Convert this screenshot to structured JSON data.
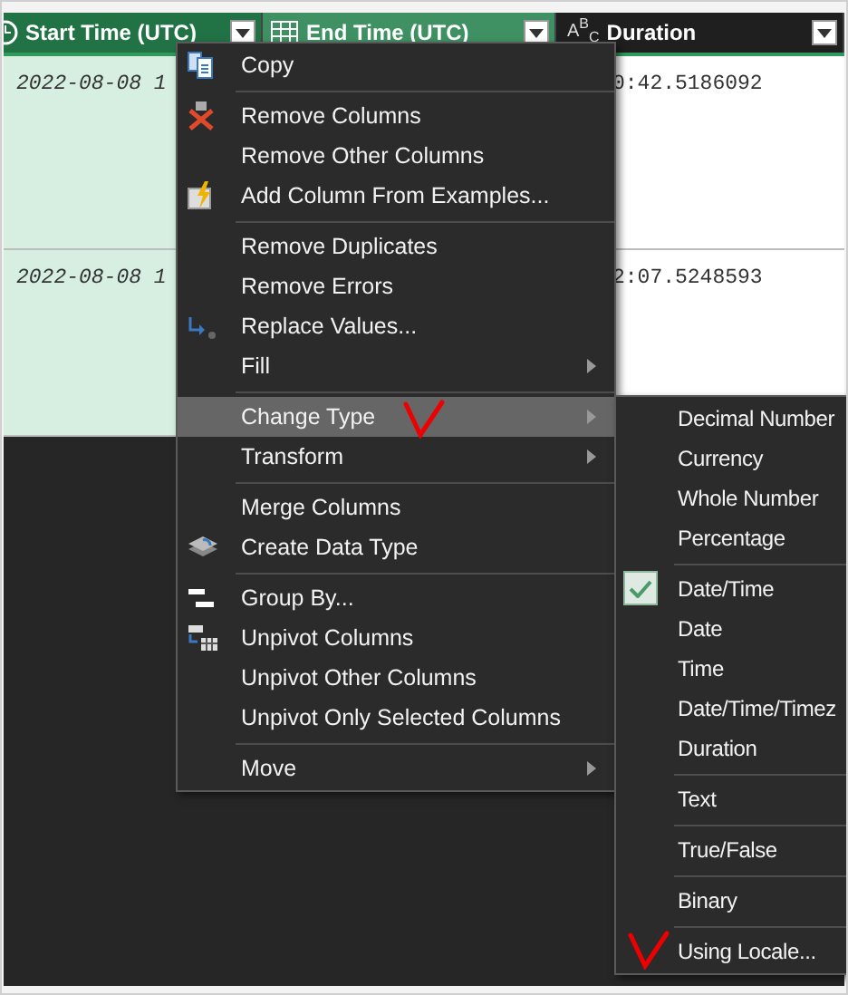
{
  "columns": [
    {
      "label": "Start Time (UTC)",
      "selected": true,
      "hovered": false
    },
    {
      "label": "End Time (UTC)",
      "selected": true,
      "hovered": true
    },
    {
      "label": "Duration",
      "selected": false,
      "hovered": false,
      "type_text": "A$^{B}$$_{C}$"
    }
  ],
  "rows": [
    [
      "2022-08-08 1",
      "",
      "0:42.5186092"
    ],
    [
      "2022-08-08 1",
      "",
      "2:07.5248593"
    ]
  ],
  "context_menu": {
    "groups": [
      [
        {
          "label": "Copy",
          "has_submenu": false,
          "highlighted": false
        }
      ],
      [
        {
          "label": "Remove Columns",
          "has_submenu": false,
          "highlighted": false
        },
        {
          "label": "Remove Other Columns",
          "has_submenu": false,
          "highlighted": false
        },
        {
          "label": "Add Column From Examples...",
          "has_submenu": false,
          "highlighted": false
        }
      ],
      [
        {
          "label": "Remove Duplicates",
          "has_submenu": false,
          "highlighted": false
        },
        {
          "label": "Remove Errors",
          "has_submenu": false,
          "highlighted": false
        },
        {
          "label": "Replace Values...",
          "has_submenu": false,
          "highlighted": false
        },
        {
          "label": "Fill",
          "has_submenu": true,
          "highlighted": false
        }
      ],
      [
        {
          "label": "Change Type",
          "has_submenu": true,
          "highlighted": true
        },
        {
          "label": "Transform",
          "has_submenu": true,
          "highlighted": false
        }
      ],
      [
        {
          "label": "Merge Columns",
          "has_submenu": false,
          "highlighted": false
        },
        {
          "label": "Create Data Type",
          "has_submenu": false,
          "highlighted": false
        }
      ],
      [
        {
          "label": "Group By...",
          "has_submenu": false,
          "highlighted": false
        },
        {
          "label": "Unpivot Columns",
          "has_submenu": false,
          "highlighted": false
        },
        {
          "label": "Unpivot Other Columns",
          "has_submenu": false,
          "highlighted": false
        },
        {
          "label": "Unpivot Only Selected Columns",
          "has_submenu": false,
          "highlighted": false
        }
      ],
      [
        {
          "label": "Move",
          "has_submenu": true,
          "highlighted": false
        }
      ]
    ]
  },
  "type_submenu": {
    "groups": [
      [
        {
          "label": "Decimal Number",
          "checked": false
        },
        {
          "label": "Currency",
          "checked": false
        },
        {
          "label": "Whole Number",
          "checked": false
        },
        {
          "label": "Percentage",
          "checked": false
        }
      ],
      [
        {
          "label": "Date/Time",
          "checked": true
        },
        {
          "label": "Date",
          "checked": false
        },
        {
          "label": "Time",
          "checked": false
        },
        {
          "label": "Date/Time/Timez",
          "checked": false
        },
        {
          "label": "Duration",
          "checked": false
        }
      ],
      [
        {
          "label": "Text",
          "checked": false
        }
      ],
      [
        {
          "label": "True/False",
          "checked": false
        }
      ],
      [
        {
          "label": "Binary",
          "checked": false
        }
      ],
      [
        {
          "label": "Using Locale...",
          "checked": false
        }
      ]
    ]
  }
}
